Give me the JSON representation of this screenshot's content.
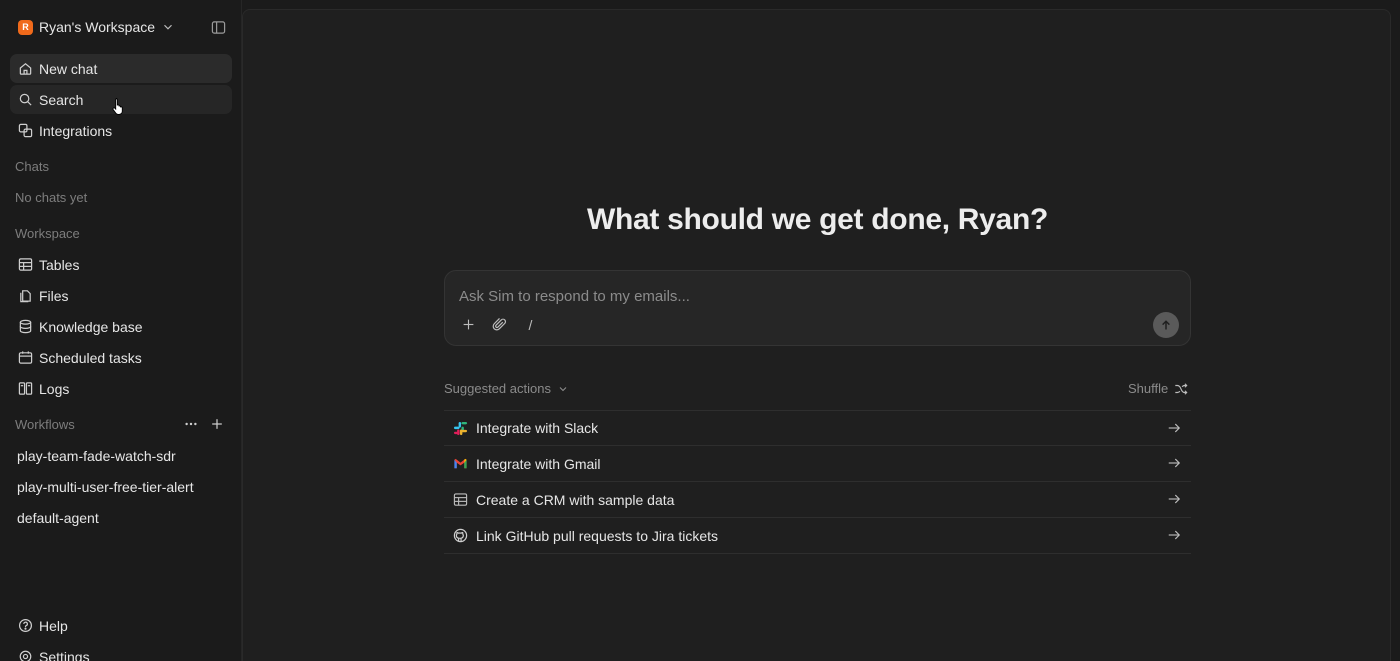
{
  "workspace": {
    "logo_letter": "R",
    "logo_color": "#f06a1b",
    "name": "Ryan's Workspace"
  },
  "nav": {
    "new_chat": "New chat",
    "search": "Search",
    "integrations": "Integrations"
  },
  "chats": {
    "section_label": "Chats",
    "empty_text": "No chats yet"
  },
  "workspace_section": {
    "label": "Workspace",
    "items": [
      "Tables",
      "Files",
      "Knowledge base",
      "Scheduled tasks",
      "Logs"
    ]
  },
  "workflows": {
    "label": "Workflows",
    "items": [
      "play-team-fade-watch-sdr",
      "play-multi-user-free-tier-alert",
      "default-agent"
    ]
  },
  "footer": {
    "help": "Help",
    "settings": "Settings"
  },
  "main": {
    "headline": "What should we get done, Ryan?",
    "composer_placeholder": "Ask Sim to respond to my emails...",
    "slash_glyph": "/",
    "suggested_label": "Suggested actions",
    "shuffle_label": "Shuffle",
    "suggestions": [
      {
        "label": "Integrate with Slack",
        "icon": "slack-icon"
      },
      {
        "label": "Integrate with Gmail",
        "icon": "gmail-icon"
      },
      {
        "label": "Create a CRM with sample data",
        "icon": "table-icon"
      },
      {
        "label": "Link GitHub pull requests to Jira tickets",
        "icon": "github-icon"
      }
    ]
  },
  "colors": {
    "background": "#1b1b1b",
    "main_panel": "#1f1f1f",
    "accent": "#f06a1b",
    "muted": "#7d7d7d"
  }
}
